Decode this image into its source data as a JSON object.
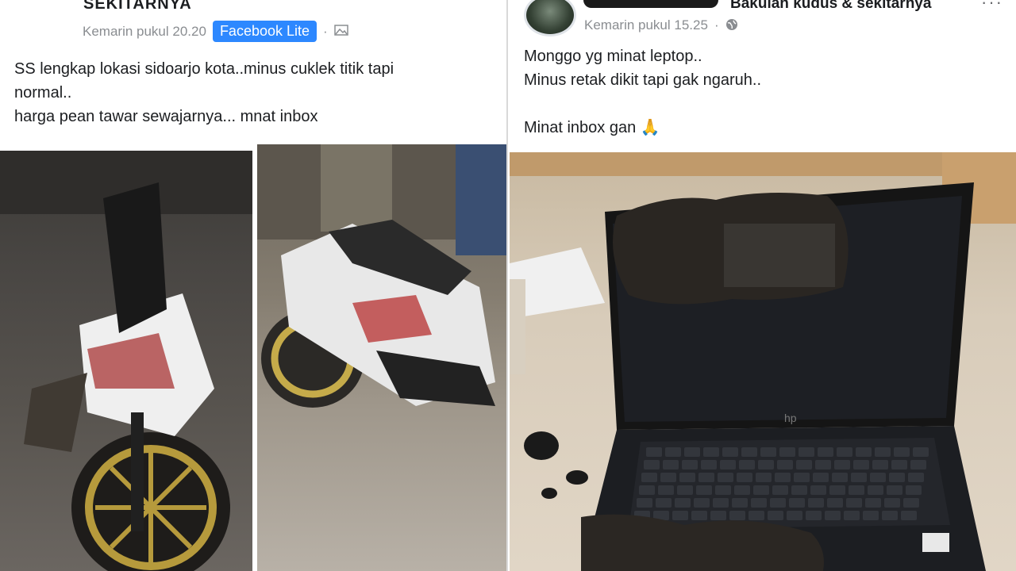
{
  "left_post": {
    "group_name": "SEKITARNYA",
    "timestamp": "Kemarin pukul 20.20",
    "app_badge": "Facebook Lite",
    "separator": "·",
    "text": "SS lengkap lokasi sidoarjo kota..minus cuklek titik tapi\nnormal..\nharga pean tawar sewajarnya... mnat inbox"
  },
  "right_post": {
    "group_name": "Bakulan kudus & sekitarnya",
    "timestamp": "Kemarin pukul 15.25",
    "separator": "·",
    "text": "Monggo yg minat leptop..\nMinus retak dikit tapi gak ngaruh..\n\nMinat inbox gan 🙏",
    "laptop_brand": "hp"
  },
  "icons": {
    "photo_icon": "image-icon",
    "globe_icon": "globe-icon",
    "more_icon": "more-options-icon"
  }
}
